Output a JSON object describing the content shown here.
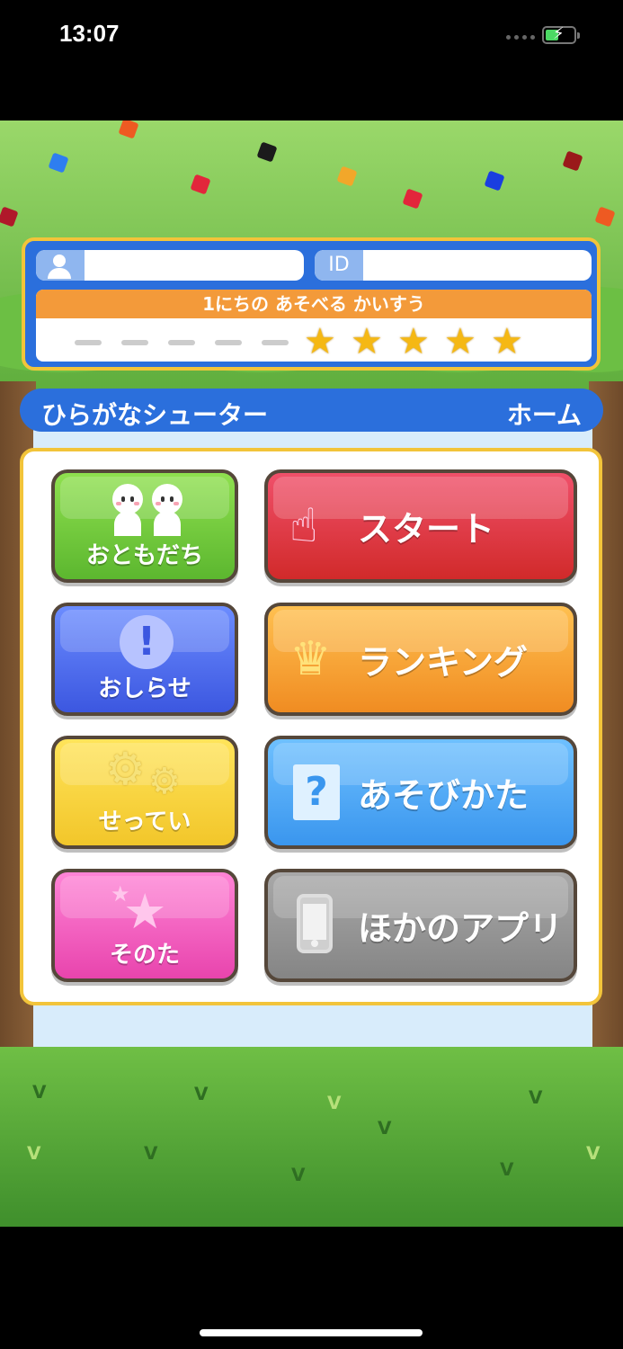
{
  "status_bar": {
    "time": "13:07"
  },
  "profile": {
    "name_value": "",
    "id_label": "ID",
    "id_value": "",
    "plays_header": "1にちの あそべる かいすう",
    "plays_remaining": 5,
    "plays_max": 10
  },
  "title_bar": {
    "app_title": "ひらがなシューター",
    "screen_title": "ホーム"
  },
  "menu": {
    "friends": "おともだち",
    "start": "スタート",
    "news": "おしらせ",
    "ranking": "ランキング",
    "settings": "せってい",
    "howto": "あそびかた",
    "other": "そのた",
    "other_apps": "ほかのアプリ"
  },
  "icons": {
    "friends": "two-people-icon",
    "start": "pointing-hand-icon",
    "news": "exclamation-icon",
    "ranking": "crown-icon",
    "settings": "gears-icon",
    "howto": "question-icon",
    "other": "star-icon",
    "other_apps": "smartphone-icon"
  },
  "colors": {
    "friends": "#5cb72f",
    "start": "#d12a2a",
    "news": "#3c57e0",
    "ranking": "#f08c22",
    "settings": "#f2c62a",
    "howto": "#3a96ee",
    "other": "#e844ad",
    "other_apps": "#858585",
    "header_blue": "#2b6fdc",
    "frame_gold": "#f2c43a"
  }
}
